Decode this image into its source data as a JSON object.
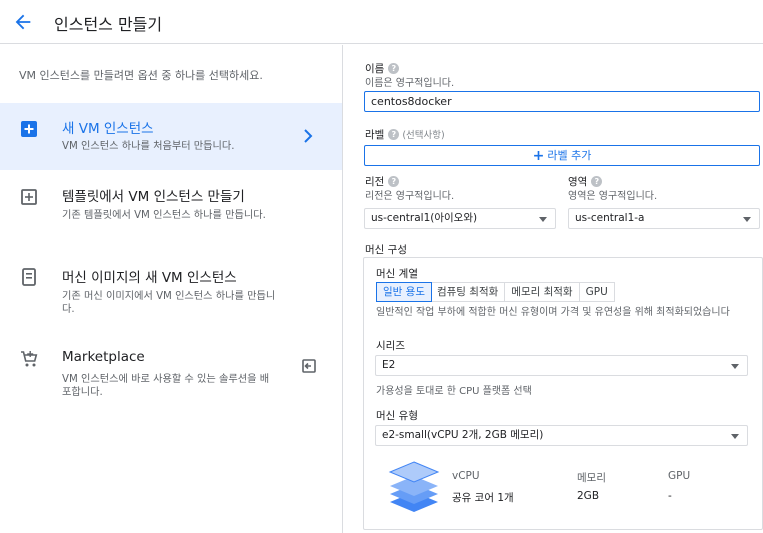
{
  "header": {
    "title": "인스턴스 만들기",
    "accent": "#1a73e8"
  },
  "left": {
    "intro": "VM 인스턴스를 만들려면 옵션 중 하나를 선택하세요.",
    "options": [
      {
        "title": "새 VM 인스턴스",
        "desc": "VM 인스턴스 하나를 처음부터 만듭니다.",
        "icon": "add-box-icon",
        "selected": true
      },
      {
        "title": "템플릿에서 VM 인스턴스 만들기",
        "desc": "기존 템플릿에서 VM 인스턴스 하나를 만듭니다.",
        "icon": "template-add-icon"
      },
      {
        "title": "머신 이미지의 새 VM 인스턴스",
        "desc": "기존 머신 이미지에서 VM 인스턴스 하나를 만듭니다.",
        "icon": "machine-image-icon"
      },
      {
        "title": "Marketplace",
        "desc": "VM 인스턴스에 바로 사용할 수 있는 솔루션을 배포합니다.",
        "icon": "cart-icon"
      }
    ]
  },
  "form": {
    "name_label": "이름",
    "name_sub": "이름은 영구적입니다.",
    "name_value": "centos8docker",
    "labels_label": "라벨",
    "labels_optional": "(선택사항)",
    "add_label_btn": "라벨 추가",
    "region_label": "리전",
    "region_sub": "리전은 영구적입니다.",
    "region_value": "us-central1(아이오와)",
    "zone_label": "영역",
    "zone_sub": "영역은 영구적입니다.",
    "zone_value": "us-central1-a",
    "machine_config_label": "머신 구성",
    "family_label": "머신 계열",
    "tabs": [
      "일반 용도",
      "컴퓨팅 최적화",
      "메모리 최적화",
      "GPU"
    ],
    "family_desc": "일반적인 작업 부하에 적합한 머신 유형이며 가격 및 유연성을 위해 최적화되었습니다",
    "series_label": "시리즈",
    "series_value": "E2",
    "series_desc": "가용성을 토대로 한 CPU 플랫폼 선택",
    "type_label": "머신 유형",
    "type_value": "e2-small(vCPU 2개, 2GB 메모리)",
    "spec": {
      "vcpu_h": "vCPU",
      "mem_h": "메모리",
      "gpu_h": "GPU",
      "vcpu_v": "공유 코어 1개",
      "mem_v": "2GB",
      "gpu_v": "-"
    }
  }
}
